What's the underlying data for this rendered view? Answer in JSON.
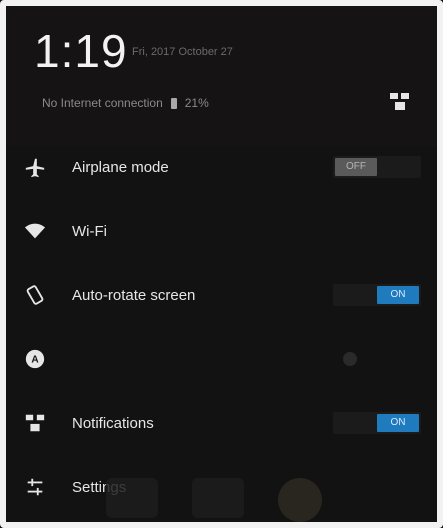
{
  "status": {
    "time": "1:19",
    "date": "Fri, 2017 October 27",
    "network": "No Internet connection",
    "battery": "21%"
  },
  "quick_settings": [
    {
      "name": "airplane",
      "label": "Airplane mode",
      "icon": "airplane-icon",
      "state": "OFF"
    },
    {
      "name": "wifi",
      "label": "Wi-Fi",
      "icon": "wifi-icon"
    },
    {
      "name": "auto-rotate",
      "label": "Auto-rotate screen",
      "icon": "rotate-icon",
      "state": "ON"
    },
    {
      "name": "brightness",
      "label": "",
      "icon": "auto-brightness-icon"
    },
    {
      "name": "notifications",
      "label": "Notifications",
      "icon": "notifications-icon",
      "state": "ON"
    },
    {
      "name": "settings",
      "label": "Settings",
      "icon": "settings-icon"
    }
  ],
  "colors": {
    "accent": "#1f7bbd",
    "background": "#131212"
  }
}
